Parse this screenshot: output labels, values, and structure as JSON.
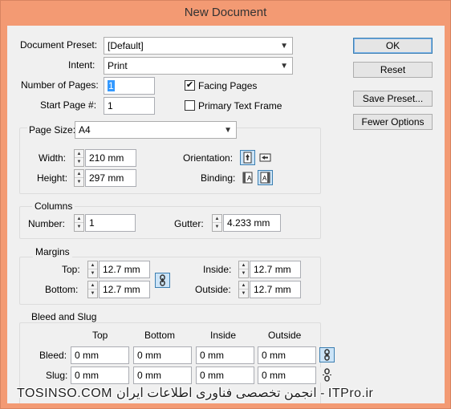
{
  "window": {
    "title": "New Document"
  },
  "document_preset": {
    "label": "Document Preset:",
    "value": "[Default]"
  },
  "intent": {
    "label": "Intent:",
    "value": "Print"
  },
  "number_of_pages": {
    "label": "Number of Pages:",
    "value": "1"
  },
  "start_page": {
    "label": "Start Page #:",
    "value": "1"
  },
  "facing_pages": {
    "label": "Facing Pages",
    "checked": true,
    "mark": "✔"
  },
  "primary_text_frame": {
    "label": "Primary Text Frame",
    "checked": false
  },
  "page_size": {
    "label": "Page Size:",
    "value": "A4"
  },
  "width": {
    "label": "Width:",
    "value": "210 mm"
  },
  "height": {
    "label": "Height:",
    "value": "297 mm"
  },
  "orientation": {
    "label": "Orientation:",
    "selected": "portrait"
  },
  "binding": {
    "label": "Binding:",
    "selected": "left-to-right"
  },
  "columns": {
    "title": "Columns",
    "number_label": "Number:",
    "number_value": "1",
    "gutter_label": "Gutter:",
    "gutter_value": "4.233 mm"
  },
  "margins": {
    "title": "Margins",
    "top_label": "Top:",
    "top_value": "12.7 mm",
    "bottom_label": "Bottom:",
    "bottom_value": "12.7 mm",
    "inside_label": "Inside:",
    "inside_value": "12.7 mm",
    "outside_label": "Outside:",
    "outside_value": "12.7 mm"
  },
  "bleed_slug": {
    "title": "Bleed and Slug",
    "col_headers": [
      "Top",
      "Bottom",
      "Inside",
      "Outside"
    ],
    "bleed_label": "Bleed:",
    "bleed_values": [
      "0 mm",
      "0 mm",
      "0 mm",
      "0 mm"
    ],
    "slug_label": "Slug:",
    "slug_values": [
      "0 mm",
      "0 mm",
      "0 mm",
      "0 mm"
    ]
  },
  "buttons": {
    "ok": "OK",
    "reset": "Reset",
    "save_preset": "Save Preset...",
    "fewer_options": "Fewer Options"
  },
  "watermark": "TOSINSO.COM   انجمن تخصصی فناوری اطلاعات ایران - ITPro.ir",
  "colors": {
    "titlebar": "#f39a73",
    "accent": "#3399ff",
    "active_icon": "#cce4f7"
  }
}
